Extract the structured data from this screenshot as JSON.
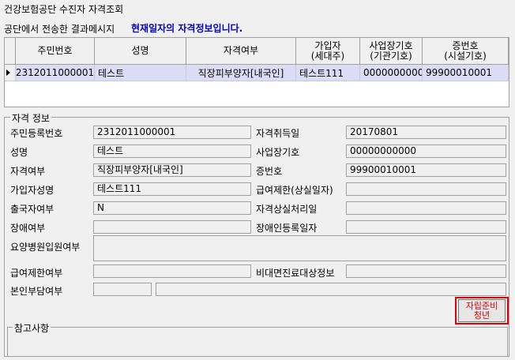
{
  "window": {
    "title": "건강보험공단 수진자 자격조회"
  },
  "message": {
    "prefix": "공단에서 전송한 결과메시지",
    "highlight": "현재일자의 자격정보입니다."
  },
  "grid": {
    "headers": [
      {
        "line1": "주민번호",
        "line2": ""
      },
      {
        "line1": "성명",
        "line2": ""
      },
      {
        "line1": "자격여부",
        "line2": ""
      },
      {
        "line1": "가입자",
        "line2": "(세대주)"
      },
      {
        "line1": "사업장기호",
        "line2": "(기관기호)"
      },
      {
        "line1": "증번호",
        "line2": "(시설기호)"
      }
    ],
    "rows": [
      {
        "ssn": "2312011000001",
        "name": "테스트",
        "status": "직장피부양자[내국인]",
        "subscriber": "테스트111",
        "biz_code": "00000000000",
        "card_no": "99900010001"
      }
    ]
  },
  "info": {
    "legend": "자격 정보",
    "fields": {
      "ssn": {
        "label": "주민등록번호",
        "value": "2312011000001"
      },
      "acquired": {
        "label": "자격취득일",
        "value": "20170801"
      },
      "name": {
        "label": "성명",
        "value": "테스트"
      },
      "biz": {
        "label": "사업장기호",
        "value": "00000000000"
      },
      "status": {
        "label": "자격여부",
        "value": "직장피부양자[내국인]"
      },
      "card": {
        "label": "증번호",
        "value": "99900010001"
      },
      "subscriber": {
        "label": "가입자성명",
        "value": "테스트111"
      },
      "restrict": {
        "label": "급여제한(상실일자)",
        "value": ""
      },
      "departure": {
        "label": "출국자여부",
        "value": "N"
      },
      "loss": {
        "label": "자격상실처리일",
        "value": ""
      },
      "disability": {
        "label": "장애여부",
        "value": ""
      },
      "disability_reg": {
        "label": "장애인등록일자",
        "value": ""
      },
      "nursing": {
        "label": "요양병원입원여부",
        "value": ""
      },
      "benefit_restrict": {
        "label": "급여제한여부",
        "value": ""
      },
      "nonface": {
        "label": "비대면진료대상정보",
        "value": ""
      },
      "copay": {
        "label": "본인부담여부",
        "value": ""
      }
    }
  },
  "button": {
    "line1": "자립준비",
    "line2": "청년"
  },
  "reference": {
    "legend": "참고사항"
  }
}
